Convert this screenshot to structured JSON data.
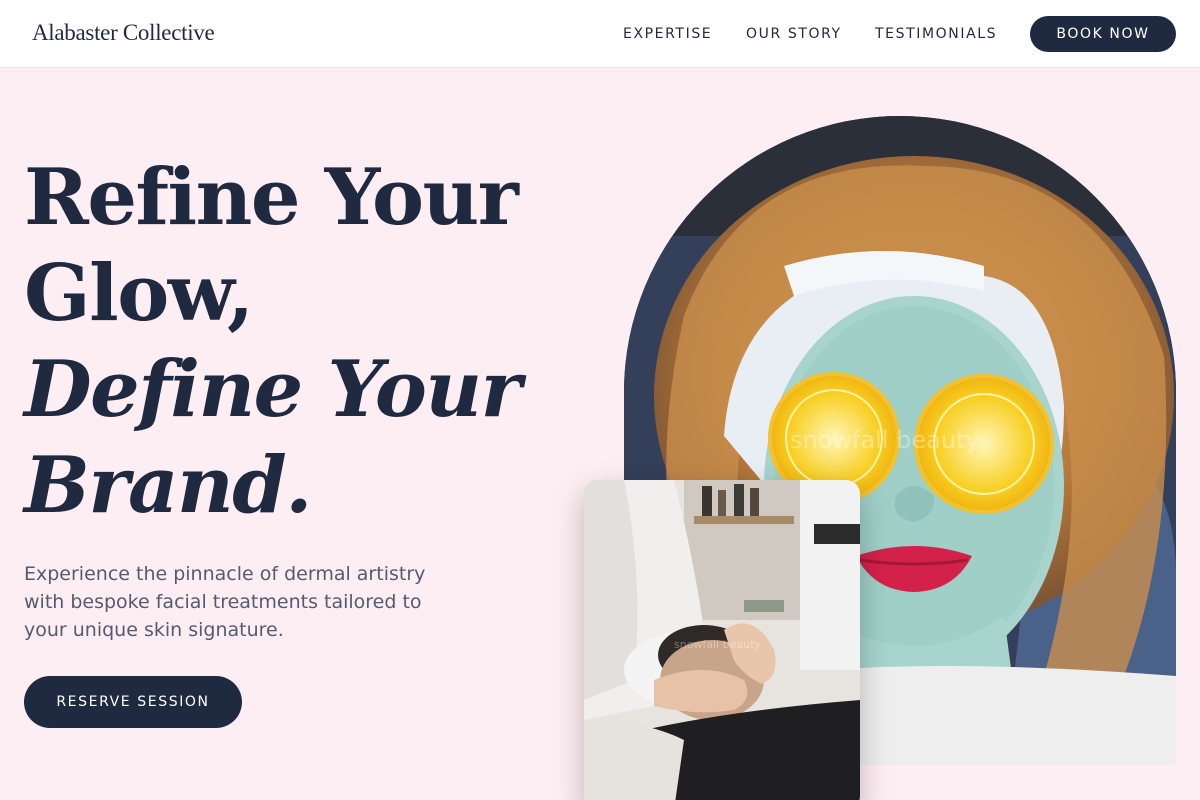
{
  "header": {
    "logo": "Alabaster Collective",
    "nav": [
      "EXPERTISE",
      "OUR STORY",
      "TESTIMONIALS"
    ],
    "cta": "BOOK NOW"
  },
  "hero": {
    "headline_line1": "Refine Your",
    "headline_line2": "Glow,",
    "headline_line3": "Define Your",
    "headline_line4": "Brand.",
    "subtext": "Experience the pinnacle of dermal artistry with bespoke facial treatments tailored to your unique skin signature.",
    "cta": "RESERVE SESSION"
  },
  "images": {
    "main_watermark": "snowfall beauty",
    "card_watermark": "snowfall beauty"
  },
  "colors": {
    "background": "#fdeef3",
    "navy": "#1f2940",
    "text_muted": "#555b6e"
  }
}
